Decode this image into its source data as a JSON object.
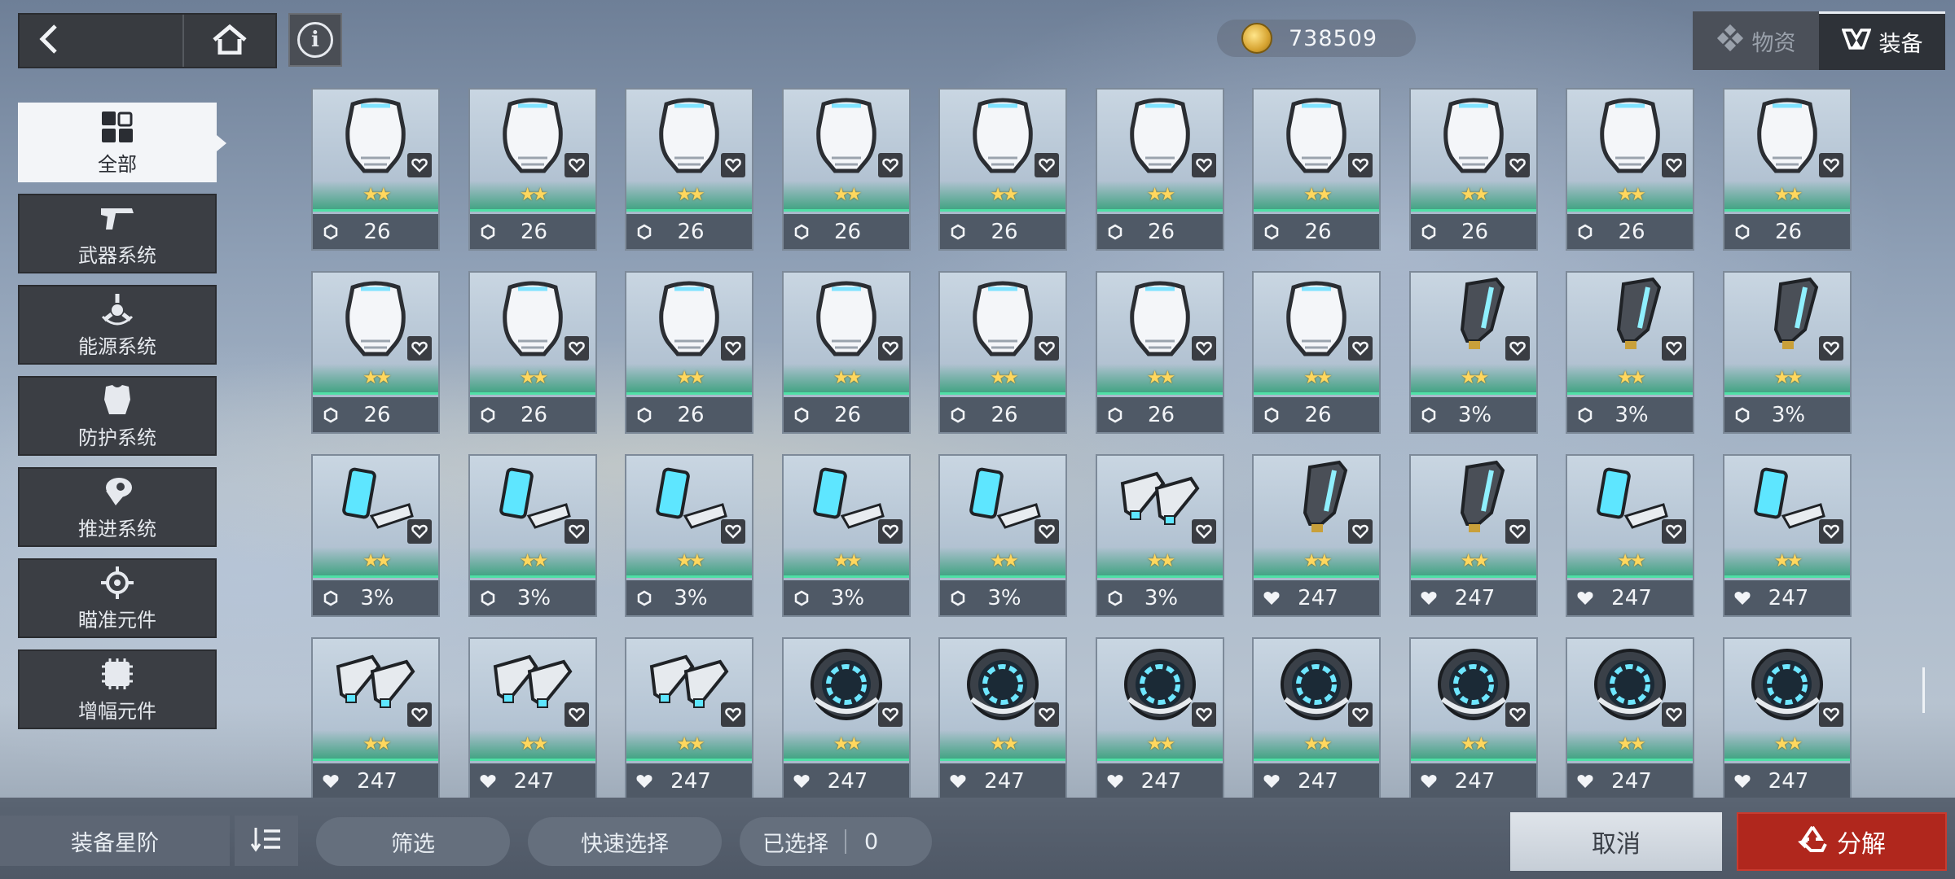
{
  "header": {
    "back_icon": "chevron-left-icon",
    "home_icon": "home-icon",
    "info_label": "i",
    "currency_icon": "gold-coin-icon",
    "currency_value": "738509",
    "tabs": [
      {
        "label": "物资",
        "icon": "supplies-icon",
        "active": false
      },
      {
        "label": "装备",
        "icon": "equipment-icon",
        "active": true
      }
    ]
  },
  "sidebar": {
    "items": [
      {
        "label": "全部",
        "icon": "grid-icon",
        "active": true
      },
      {
        "label": "武器系统",
        "icon": "pistol-icon",
        "active": false
      },
      {
        "label": "能源系统",
        "icon": "energy-icon",
        "active": false
      },
      {
        "label": "防护系统",
        "icon": "armor-icon",
        "active": false
      },
      {
        "label": "推进系统",
        "icon": "thruster-icon",
        "active": false
      },
      {
        "label": "瞄准元件",
        "icon": "crosshair-icon",
        "active": false
      },
      {
        "label": "增幅元件",
        "icon": "chip-icon",
        "active": false
      }
    ]
  },
  "inventory": {
    "items": [
      {
        "kind": "armor",
        "stars": "★★",
        "stat_icon": "shield-icon",
        "value": "26"
      },
      {
        "kind": "armor",
        "stars": "★★",
        "stat_icon": "shield-icon",
        "value": "26"
      },
      {
        "kind": "armor",
        "stars": "★★",
        "stat_icon": "shield-icon",
        "value": "26"
      },
      {
        "kind": "armor",
        "stars": "★★",
        "stat_icon": "shield-icon",
        "value": "26"
      },
      {
        "kind": "armor",
        "stars": "★★",
        "stat_icon": "shield-icon",
        "value": "26"
      },
      {
        "kind": "armor",
        "stars": "★★",
        "stat_icon": "shield-icon",
        "value": "26"
      },
      {
        "kind": "armor",
        "stars": "★★",
        "stat_icon": "shield-icon",
        "value": "26"
      },
      {
        "kind": "armor",
        "stars": "★★",
        "stat_icon": "shield-icon",
        "value": "26"
      },
      {
        "kind": "armor",
        "stars": "★★",
        "stat_icon": "shield-icon",
        "value": "26"
      },
      {
        "kind": "armor",
        "stars": "★★",
        "stat_icon": "shield-icon",
        "value": "26"
      },
      {
        "kind": "armor",
        "stars": "★★",
        "stat_icon": "shield-icon",
        "value": "26"
      },
      {
        "kind": "armor",
        "stars": "★★",
        "stat_icon": "shield-icon",
        "value": "26"
      },
      {
        "kind": "armor",
        "stars": "★★",
        "stat_icon": "shield-icon",
        "value": "26"
      },
      {
        "kind": "armor",
        "stars": "★★",
        "stat_icon": "shield-icon",
        "value": "26"
      },
      {
        "kind": "armor",
        "stars": "★★",
        "stat_icon": "shield-icon",
        "value": "26"
      },
      {
        "kind": "armor",
        "stars": "★★",
        "stat_icon": "shield-icon",
        "value": "26"
      },
      {
        "kind": "armor",
        "stars": "★★",
        "stat_icon": "shield-icon",
        "value": "26"
      },
      {
        "kind": "boot",
        "stars": "★★",
        "stat_icon": "shield-icon",
        "value": "3%"
      },
      {
        "kind": "boot",
        "stars": "★★",
        "stat_icon": "shield-icon",
        "value": "3%"
      },
      {
        "kind": "boot",
        "stars": "★★",
        "stat_icon": "shield-icon",
        "value": "3%"
      },
      {
        "kind": "panel",
        "stars": "★★",
        "stat_icon": "shield-icon",
        "value": "3%"
      },
      {
        "kind": "panel",
        "stars": "★★",
        "stat_icon": "shield-icon",
        "value": "3%"
      },
      {
        "kind": "panel",
        "stars": "★★",
        "stat_icon": "shield-icon",
        "value": "3%"
      },
      {
        "kind": "panel",
        "stars": "★★",
        "stat_icon": "shield-icon",
        "value": "3%"
      },
      {
        "kind": "panel",
        "stars": "★★",
        "stat_icon": "shield-icon",
        "value": "3%"
      },
      {
        "kind": "thruster",
        "stars": "★★",
        "stat_icon": "shield-icon",
        "value": "3%"
      },
      {
        "kind": "boot",
        "stars": "★★",
        "stat_icon": "heart-icon",
        "value": "247"
      },
      {
        "kind": "boot",
        "stars": "★★",
        "stat_icon": "heart-icon",
        "value": "247"
      },
      {
        "kind": "panel",
        "stars": "★★",
        "stat_icon": "heart-icon",
        "value": "247"
      },
      {
        "kind": "panel",
        "stars": "★★",
        "stat_icon": "heart-icon",
        "value": "247"
      },
      {
        "kind": "thruster",
        "stars": "★★",
        "stat_icon": "heart-icon",
        "value": "247"
      },
      {
        "kind": "thruster",
        "stars": "★★",
        "stat_icon": "heart-icon",
        "value": "247"
      },
      {
        "kind": "thruster",
        "stars": "★★",
        "stat_icon": "heart-icon",
        "value": "247"
      },
      {
        "kind": "core",
        "stars": "★★",
        "stat_icon": "heart-icon",
        "value": "247"
      },
      {
        "kind": "core",
        "stars": "★★",
        "stat_icon": "heart-icon",
        "value": "247"
      },
      {
        "kind": "core",
        "stars": "★★",
        "stat_icon": "heart-icon",
        "value": "247"
      },
      {
        "kind": "core",
        "stars": "★★",
        "stat_icon": "heart-icon",
        "value": "247"
      },
      {
        "kind": "core",
        "stars": "★★",
        "stat_icon": "heart-icon",
        "value": "247"
      },
      {
        "kind": "core",
        "stars": "★★",
        "stat_icon": "heart-icon",
        "value": "247"
      },
      {
        "kind": "core",
        "stars": "★★",
        "stat_icon": "heart-icon",
        "value": "247"
      }
    ]
  },
  "footer": {
    "sort_label": "装备星阶",
    "sort_toggle_icon": "sort-order-icon",
    "filter_label": "筛选",
    "quick_select_label": "快速选择",
    "selected_label": "已选择",
    "selected_count": "0",
    "cancel_label": "取消",
    "decompose_label": "分解",
    "decompose_icon": "recycle-icon"
  },
  "colors": {
    "accent_green": "#4fe0a6",
    "star_gold": "#ffd75e",
    "decompose_red": "#b0271d"
  }
}
